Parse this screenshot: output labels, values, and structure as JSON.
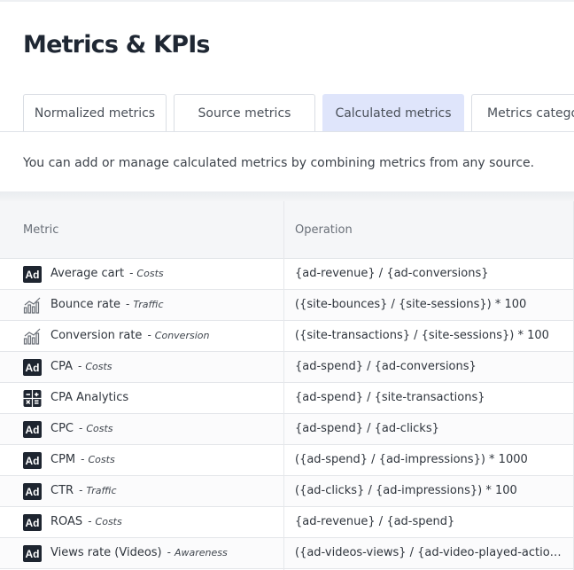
{
  "page": {
    "title": "Metrics & KPIs"
  },
  "tabs": [
    {
      "label": "Normalized metrics",
      "active": false
    },
    {
      "label": "Source metrics",
      "active": false
    },
    {
      "label": "Calculated metrics",
      "active": true
    },
    {
      "label": "Metrics categories",
      "active": false
    }
  ],
  "description": "You can add or manage calculated metrics by combining metrics from any source.",
  "table": {
    "headers": {
      "metric": "Metric",
      "operation": "Operation"
    },
    "rows": [
      {
        "icon": "ad-icon",
        "icon_text": "Ad",
        "name": "Average cart",
        "sep": "-",
        "category": "Costs",
        "operation": "{ad-revenue} / {ad-conversions}"
      },
      {
        "icon": "analytics-chart-icon",
        "name": "Bounce rate",
        "sep": "-",
        "category": "Traffic",
        "operation": "({site-bounces} / {site-sessions}) * 100"
      },
      {
        "icon": "analytics-chart-icon",
        "name": "Conversion rate",
        "sep": "-",
        "category": "Conversion",
        "operation": "({site-transactions} / {site-sessions}) * 100"
      },
      {
        "icon": "ad-icon",
        "icon_text": "Ad",
        "name": "CPA",
        "sep": "-",
        "category": "Costs",
        "operation": "{ad-spend} / {ad-conversions}"
      },
      {
        "icon": "calculator-icon",
        "name": "CPA Analytics",
        "sep": "",
        "category": "",
        "operation": "{ad-spend} / {site-transactions}"
      },
      {
        "icon": "ad-icon",
        "icon_text": "Ad",
        "name": "CPC",
        "sep": "-",
        "category": "Costs",
        "operation": "{ad-spend} / {ad-clicks}"
      },
      {
        "icon": "ad-icon",
        "icon_text": "Ad",
        "name": "CPM",
        "sep": "-",
        "category": "Costs",
        "operation": "({ad-spend} / {ad-impressions}) * 1000"
      },
      {
        "icon": "ad-icon",
        "icon_text": "Ad",
        "name": "CTR",
        "sep": "-",
        "category": "Traffic",
        "operation": "({ad-clicks} / {ad-impressions}) * 100"
      },
      {
        "icon": "ad-icon",
        "icon_text": "Ad",
        "name": "ROAS",
        "sep": "-",
        "category": "Costs",
        "operation": "{ad-revenue} / {ad-spend}"
      },
      {
        "icon": "ad-icon",
        "icon_text": "Ad",
        "name": "Views rate (Videos)",
        "sep": "-",
        "category": "Awareness",
        "operation": "({ad-videos-views} / {ad-video-played-actions..."
      }
    ]
  },
  "colors": {
    "active_tab": "#dfe5fb",
    "title": "#1f2733",
    "icon_dark": "#1e2530"
  }
}
